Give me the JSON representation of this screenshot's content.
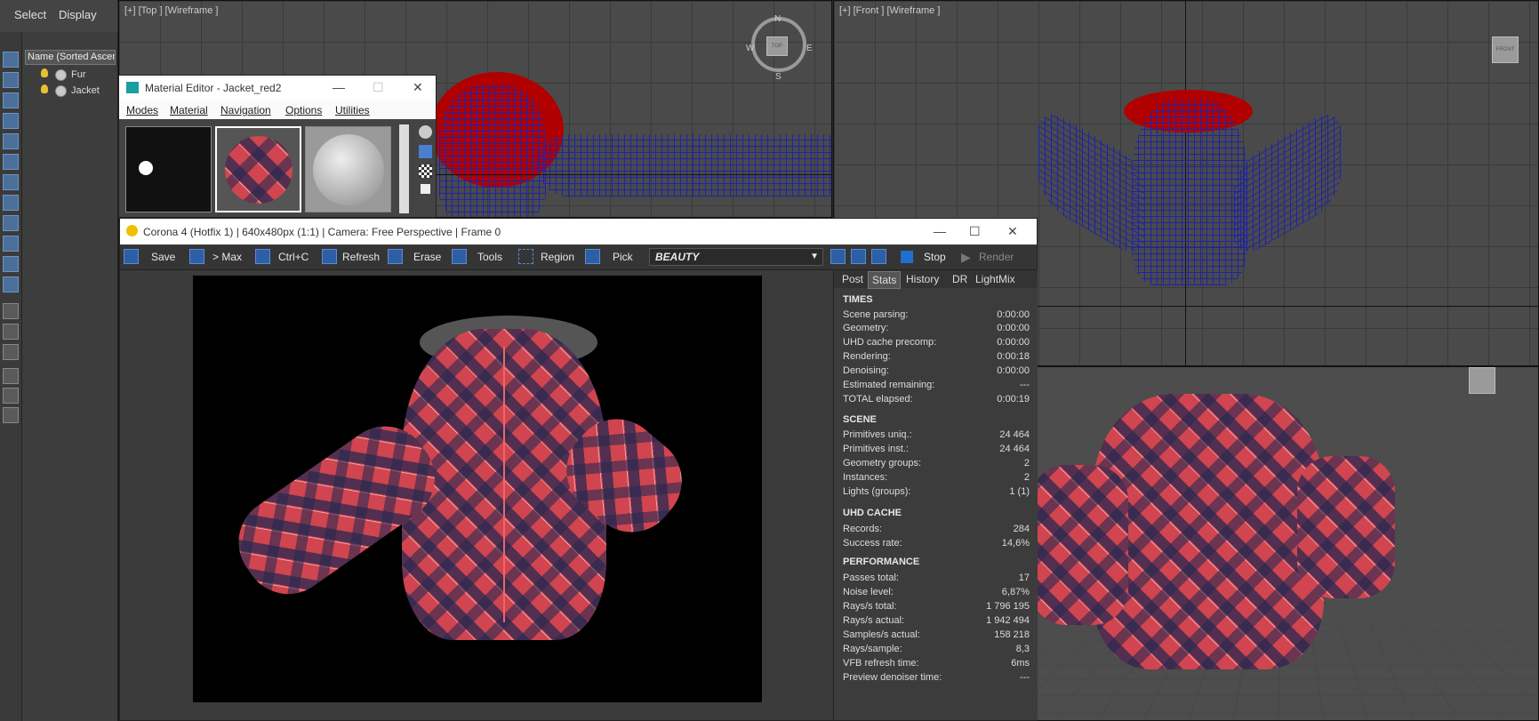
{
  "explorer": {
    "menu": [
      "Select",
      "Display"
    ],
    "column_header": "Name (Sorted Ascen",
    "items": [
      {
        "label": "Fur"
      },
      {
        "label": "Jacket"
      }
    ]
  },
  "viewports": {
    "top": {
      "label": "[+] [Top ] [Wireframe ]",
      "compass": {
        "n": "N",
        "s": "S",
        "e": "E",
        "w": "W",
        "cube": "TOP"
      }
    },
    "front": {
      "label": "[+] [Front ] [Wireframe ]",
      "cube": "FRONT"
    }
  },
  "material_editor": {
    "title": "Material Editor - Jacket_red2",
    "menu": [
      "Modes",
      "Material",
      "Navigation",
      "Options",
      "Utilities"
    ]
  },
  "vfb": {
    "title": "Corona 4 (Hotfix 1) | 640x480px (1:1) | Camera: Free Perspective | Frame 0",
    "toolbar": {
      "save": "Save",
      "to_max": "> Max",
      "copy": "Ctrl+C",
      "refresh": "Refresh",
      "erase": "Erase",
      "tools": "Tools",
      "region": "Region",
      "pick": "Pick",
      "channel": "BEAUTY",
      "stop": "Stop",
      "render": "Render"
    },
    "tabs": [
      "Post",
      "Stats",
      "History",
      "DR",
      "LightMix"
    ],
    "active_tab": "Stats",
    "sections": [
      {
        "title": "TIMES",
        "rows": [
          {
            "k": "Scene parsing:",
            "v": "0:00:00"
          },
          {
            "k": "Geometry:",
            "v": "0:00:00"
          },
          {
            "k": "UHD cache precomp:",
            "v": "0:00:00"
          },
          {
            "k": "Rendering:",
            "v": "0:00:18"
          },
          {
            "k": "Denoising:",
            "v": "0:00:00"
          },
          {
            "k": "Estimated remaining:",
            "v": "---"
          },
          {
            "k": "TOTAL elapsed:",
            "v": "0:00:19"
          }
        ]
      },
      {
        "title": "SCENE",
        "rows": [
          {
            "k": "Primitives uniq.:",
            "v": "24 464"
          },
          {
            "k": "Primitives inst.:",
            "v": "24 464"
          },
          {
            "k": "Geometry groups:",
            "v": "2"
          },
          {
            "k": "Instances:",
            "v": "2"
          },
          {
            "k": "Lights (groups):",
            "v": "1 (1)"
          }
        ]
      },
      {
        "title": "UHD CACHE",
        "rows": [
          {
            "k": "Records:",
            "v": "284"
          },
          {
            "k": "Success rate:",
            "v": "14,6%"
          }
        ]
      },
      {
        "title": "PERFORMANCE",
        "rows": [
          {
            "k": "Passes total:",
            "v": "17"
          },
          {
            "k": "Noise level:",
            "v": "6,87%"
          },
          {
            "k": "Rays/s total:",
            "v": "1 796 195"
          },
          {
            "k": "Rays/s actual:",
            "v": "1 942 494"
          },
          {
            "k": "Samples/s actual:",
            "v": "158 218"
          },
          {
            "k": "Rays/sample:",
            "v": "8,3"
          },
          {
            "k": "VFB refresh time:",
            "v": "6ms"
          },
          {
            "k": "Preview denoiser time:",
            "v": "---"
          }
        ]
      }
    ]
  },
  "colors": {
    "accent": "#2d5fa6",
    "wire": "#1e23a8",
    "hood": "#b00000",
    "fabric": "#d0454f"
  }
}
